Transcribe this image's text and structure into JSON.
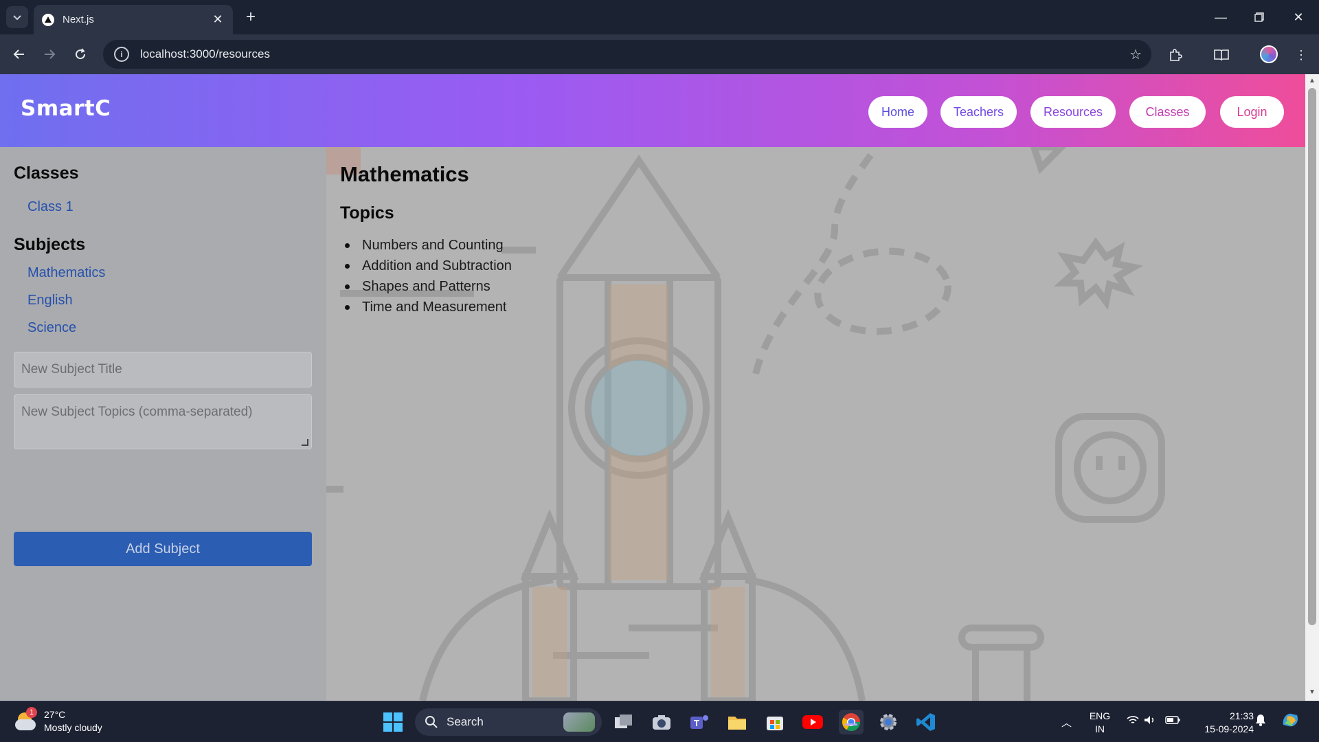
{
  "browser": {
    "tab_title": "Next.js",
    "url": "localhost:3000/resources"
  },
  "app": {
    "brand": "SmartC",
    "nav": [
      "Home",
      "Teachers",
      "Resources",
      "Classes",
      "Login"
    ],
    "colors": {
      "header_start": "#6f6ff0",
      "header_end": "#ef4d9a",
      "nav_text": "#5b3fd6",
      "link": "#2750ad",
      "button": "#2b5db3"
    }
  },
  "sidebar": {
    "classes_heading": "Classes",
    "classes": [
      "Class 1"
    ],
    "subjects_heading": "Subjects",
    "subjects": [
      "Mathematics",
      "English",
      "Science"
    ],
    "new_subject_title_placeholder": "New Subject Title",
    "new_subject_topics_placeholder": "New Subject Topics (comma-separated)",
    "add_button": "Add Subject"
  },
  "main": {
    "subject_title": "Mathematics",
    "topics_heading": "Topics",
    "topics": [
      "Numbers and Counting",
      "Addition and Subtraction",
      "Shapes and Patterns",
      "Time and Measurement"
    ]
  },
  "taskbar": {
    "weather_temp": "27°C",
    "weather_desc": "Mostly cloudy",
    "weather_badge": "1",
    "search_label": "Search",
    "lang_top": "ENG",
    "lang_bottom": "IN",
    "time": "21:33",
    "date": "15-09-2024"
  }
}
